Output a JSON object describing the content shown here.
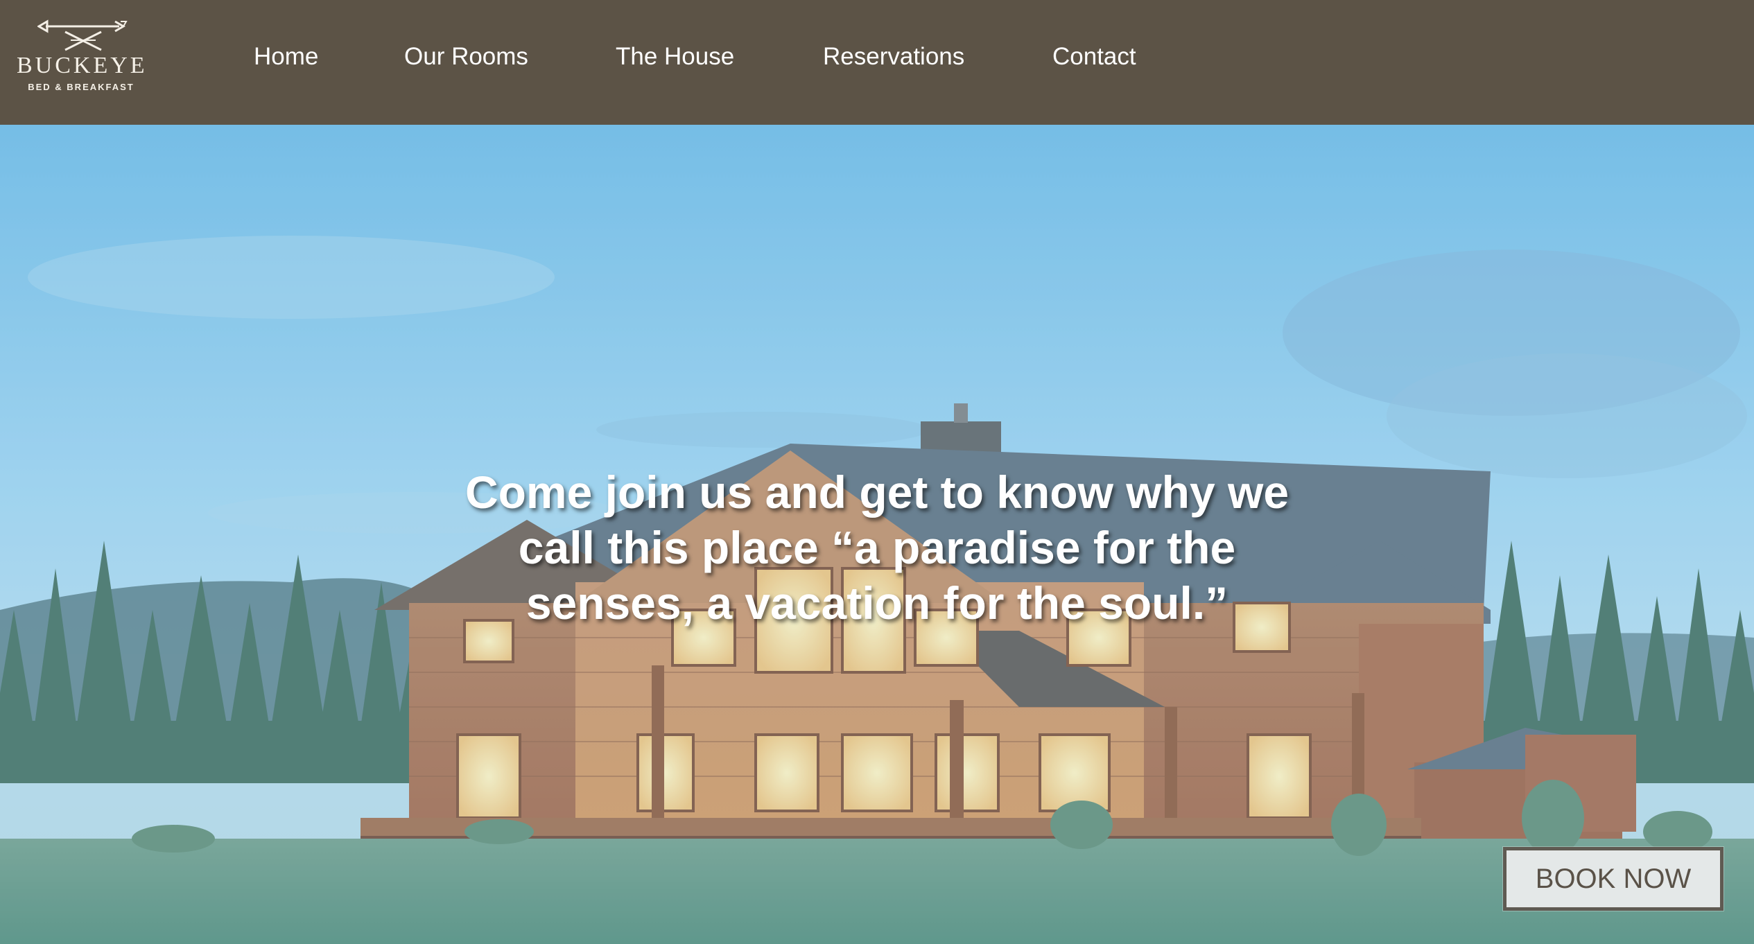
{
  "brand": {
    "name": "BUCKEYE",
    "tagline": "BED & BREAKFAST"
  },
  "nav": {
    "items": [
      {
        "label": "Home"
      },
      {
        "label": "Our Rooms"
      },
      {
        "label": "The House"
      },
      {
        "label": "Reservations"
      },
      {
        "label": "Contact"
      }
    ]
  },
  "hero": {
    "headline_line1": "Come join us and get to know why we",
    "headline_line2": "call this place “a paradise for the",
    "headline_line3": "senses, a vacation for the soul.”",
    "cta_label": "BOOK NOW"
  },
  "colors": {
    "header_bg": "#5c5346",
    "nav_text": "#ffffff",
    "button_bg": "#e4e8e8",
    "button_border": "#5f5a52"
  },
  "icons": {
    "logo": "crossed-arrows-icon"
  }
}
